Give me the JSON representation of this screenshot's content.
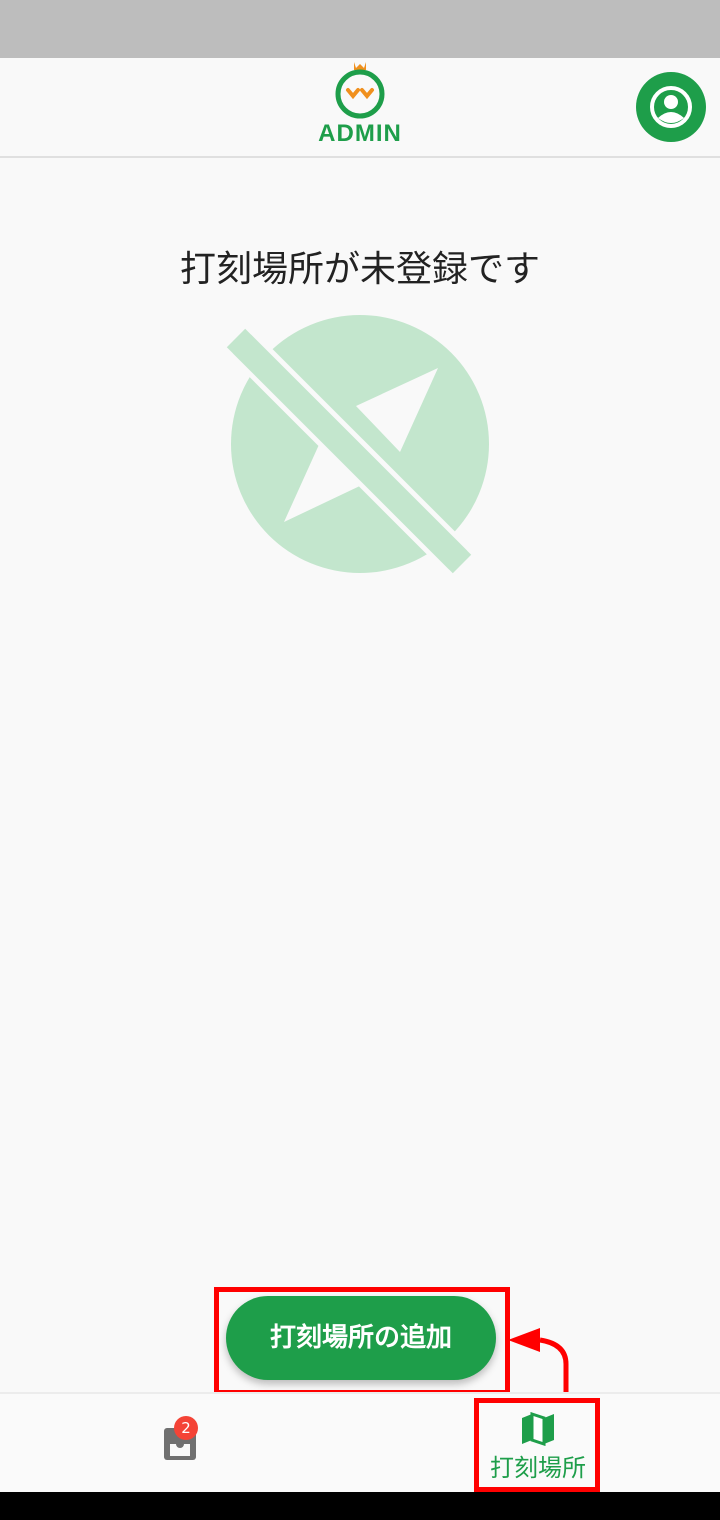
{
  "header": {
    "logo_text": "ADMIN"
  },
  "main": {
    "empty_title": "打刻場所が未登録です"
  },
  "actions": {
    "add_location_label": "打刻場所の追加"
  },
  "bottom_nav": {
    "inbox_badge_count": "2",
    "locations_label": "打刻場所"
  },
  "colors": {
    "brand_green": "#1e9e4a",
    "illustration_green": "#c3e6cd",
    "highlight_red": "#ff0000",
    "badge_red": "#f44336"
  }
}
